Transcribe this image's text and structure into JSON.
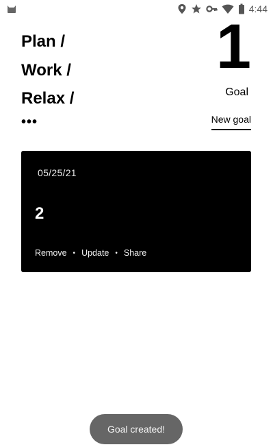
{
  "status_bar": {
    "time": "4:44",
    "icons": [
      "cat-notification-icon",
      "location-icon",
      "star-icon",
      "key-icon",
      "wifi-icon",
      "battery-icon"
    ]
  },
  "header": {
    "lines": [
      "Plan /",
      "Work /",
      "Relax /"
    ],
    "more": "•••"
  },
  "summary": {
    "count": "1",
    "label": "Goal",
    "new_goal": "New goal"
  },
  "card": {
    "date": "05/25/21",
    "value": "2",
    "actions": [
      "Remove",
      "Update",
      "Share"
    ],
    "separator": "•"
  },
  "toast": {
    "message": "Goal created!"
  }
}
